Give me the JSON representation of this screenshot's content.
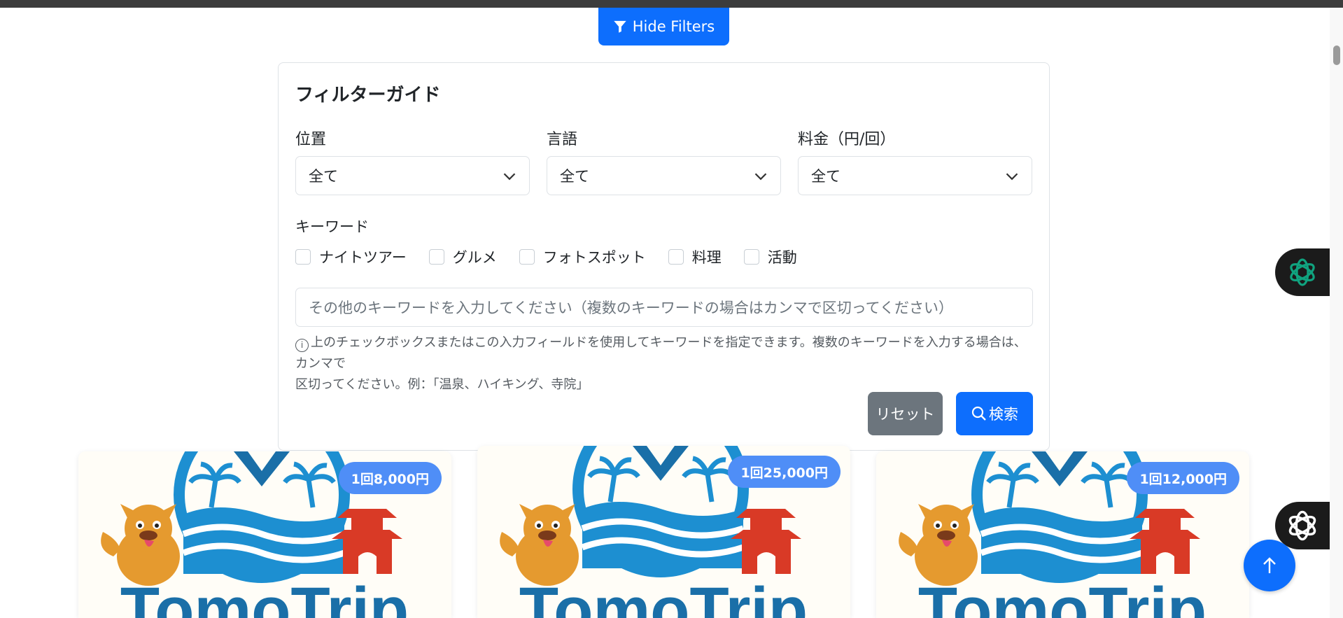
{
  "toggle": {
    "label": "Hide Filters"
  },
  "filter": {
    "title": "フィルターガイド",
    "location": {
      "label": "位置",
      "value": "全て"
    },
    "language": {
      "label": "言語",
      "value": "全て"
    },
    "price": {
      "label": "料金（円/回）",
      "value": "全て"
    },
    "keyword_label": "キーワード",
    "checkboxes": [
      "ナイトツアー",
      "グルメ",
      "フォトスポット",
      "料理",
      "活動"
    ],
    "keyword_placeholder": "その他のキーワードを入力してください（複数のキーワードの場合はカンマで区切ってください）",
    "help_line1": "上のチェックボックスまたはこの入力フィールドを使用してキーワードを指定できます。複数のキーワードを入力する場合は、カンマで",
    "help_line2": "区切ってください。例：「温泉、ハイキング、寺院」",
    "reset_label": "リセット",
    "search_label": "検索"
  },
  "cards": [
    {
      "price": "1回8,000円",
      "brand": "TomoTrip"
    },
    {
      "price": "1回25,000円",
      "brand": "TomoTrip"
    },
    {
      "price": "1回12,000円",
      "brand": "TomoTrip"
    }
  ],
  "colors": {
    "primary": "#0d6efd",
    "secondary": "#6c757d",
    "badge": "#4f8ef7",
    "brand_blue": "#1a6fa8",
    "seal_red": "#d93a26"
  }
}
